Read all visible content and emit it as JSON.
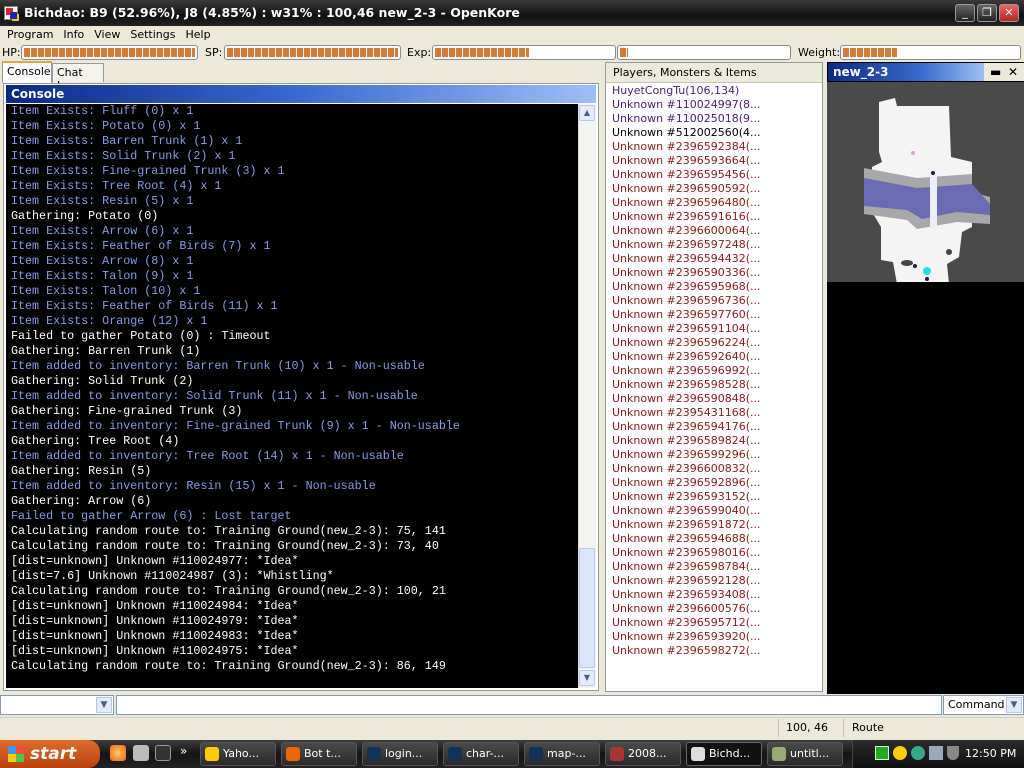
{
  "window": {
    "title": "Bichdao: B9 (52.96%), J8 (4.85%) : w31% : 100,46 new_2-3 - OpenKore"
  },
  "menu": [
    "Program",
    "Info",
    "View",
    "Settings",
    "Help"
  ],
  "stats": {
    "hp_label": "HP:",
    "sp_label": "SP:",
    "exp_label": "Exp:",
    "weight_label": "Weight:",
    "hp_percent": 100,
    "sp_percent": 100,
    "base_exp_percent": 52.96,
    "job_exp_percent": 4.85,
    "weight_percent": 31,
    "bar_color": "#d87a30"
  },
  "tabs": [
    "Console",
    "Chat Log"
  ],
  "console": {
    "title": "Console",
    "colors": {
      "info": "#8a9ae6",
      "normal": "#ffffff",
      "background": "#000000"
    },
    "lines": [
      {
        "t": "info",
        "text": "Item Exists: Fluff (0) x 1"
      },
      {
        "t": "info",
        "text": "Item Exists: Potato (0) x 1"
      },
      {
        "t": "info",
        "text": "Item Exists: Barren Trunk (1) x 1"
      },
      {
        "t": "info",
        "text": "Item Exists: Solid Trunk (2) x 1"
      },
      {
        "t": "info",
        "text": "Item Exists: Fine-grained Trunk (3) x 1"
      },
      {
        "t": "info",
        "text": "Item Exists: Tree Root (4) x 1"
      },
      {
        "t": "info",
        "text": "Item Exists: Resin (5) x 1"
      },
      {
        "t": "normal",
        "text": "Gathering: Potato (0)"
      },
      {
        "t": "info",
        "text": "Item Exists: Arrow (6) x 1"
      },
      {
        "t": "info",
        "text": "Item Exists: Feather of Birds (7) x 1"
      },
      {
        "t": "info",
        "text": "Item Exists: Arrow (8) x 1"
      },
      {
        "t": "info",
        "text": "Item Exists: Talon (9) x 1"
      },
      {
        "t": "info",
        "text": "Item Exists: Talon (10) x 1"
      },
      {
        "t": "info",
        "text": "Item Exists: Feather of Birds (11) x 1"
      },
      {
        "t": "info",
        "text": "Item Exists: Orange (12) x 1"
      },
      {
        "t": "normal",
        "text": "Failed to gather Potato (0) : Timeout"
      },
      {
        "t": "normal",
        "text": "Gathering: Barren Trunk (1)"
      },
      {
        "t": "info",
        "text": "Item added to inventory: Barren Trunk (10) x 1 - Non-usable"
      },
      {
        "t": "normal",
        "text": "Gathering: Solid Trunk (2)"
      },
      {
        "t": "info",
        "text": "Item added to inventory: Solid Trunk (11) x 1 - Non-usable"
      },
      {
        "t": "normal",
        "text": "Gathering: Fine-grained Trunk (3)"
      },
      {
        "t": "info",
        "text": "Item added to inventory: Fine-grained Trunk (9) x 1 - Non-usable"
      },
      {
        "t": "normal",
        "text": "Gathering: Tree Root (4)"
      },
      {
        "t": "info",
        "text": "Item added to inventory: Tree Root (14) x 1 - Non-usable"
      },
      {
        "t": "normal",
        "text": "Gathering: Resin (5)"
      },
      {
        "t": "info",
        "text": "Item added to inventory: Resin (15) x 1 - Non-usable"
      },
      {
        "t": "normal",
        "text": "Gathering: Arrow (6)"
      },
      {
        "t": "info",
        "text": "Failed to gather Arrow (6) : Lost target"
      },
      {
        "t": "normal",
        "text": "Calculating random route to: Training Ground(new_2-3): 75, 141"
      },
      {
        "t": "normal",
        "text": "Calculating random route to: Training Ground(new_2-3): 73, 40"
      },
      {
        "t": "normal",
        "text": "[dist=unknown] Unknown #110024977: *Idea*"
      },
      {
        "t": "normal",
        "text": "[dist=7.6] Unknown #110024987 (3): *Whistling*"
      },
      {
        "t": "normal",
        "text": "Calculating random route to: Training Ground(new_2-3): 100, 21"
      },
      {
        "t": "normal",
        "text": "[dist=unknown] Unknown #110024984: *Idea*"
      },
      {
        "t": "normal",
        "text": "[dist=unknown] Unknown #110024979: *Idea*"
      },
      {
        "t": "normal",
        "text": "[dist=unknown] Unknown #110024983: *Idea*"
      },
      {
        "t": "normal",
        "text": "[dist=unknown] Unknown #110024975: *Idea*"
      },
      {
        "t": "normal",
        "text": "Calculating random route to: Training Ground(new_2-3): 86, 149"
      }
    ]
  },
  "entities": {
    "header": "Players, Monsters & Items",
    "colors": {
      "player": "#4b1f7a",
      "npc": "#000000",
      "monster": "#8b1a1a"
    },
    "items": [
      {
        "t": "player",
        "text": "HuyetCongTu(106,134)"
      },
      {
        "t": "player",
        "text": "Unknown #110024997(8..."
      },
      {
        "t": "player",
        "text": "Unknown #110025018(9..."
      },
      {
        "t": "npc",
        "text": "Unknown #512002560(4..."
      },
      {
        "t": "monster",
        "text": "Unknown #2396592384(..."
      },
      {
        "t": "monster",
        "text": "Unknown #2396593664(..."
      },
      {
        "t": "monster",
        "text": "Unknown #2396595456(..."
      },
      {
        "t": "monster",
        "text": "Unknown #2396590592(..."
      },
      {
        "t": "monster",
        "text": "Unknown #2396596480(..."
      },
      {
        "t": "monster",
        "text": "Unknown #2396591616(..."
      },
      {
        "t": "monster",
        "text": "Unknown #2396600064(..."
      },
      {
        "t": "monster",
        "text": "Unknown #2396597248(..."
      },
      {
        "t": "monster",
        "text": "Unknown #2396594432(..."
      },
      {
        "t": "monster",
        "text": "Unknown #2396590336(..."
      },
      {
        "t": "monster",
        "text": "Unknown #2396595968(..."
      },
      {
        "t": "monster",
        "text": "Unknown #2396596736(..."
      },
      {
        "t": "monster",
        "text": "Unknown #2396597760(..."
      },
      {
        "t": "monster",
        "text": "Unknown #2396591104(..."
      },
      {
        "t": "monster",
        "text": "Unknown #2396596224(..."
      },
      {
        "t": "monster",
        "text": "Unknown #2396592640(..."
      },
      {
        "t": "monster",
        "text": "Unknown #2396596992(..."
      },
      {
        "t": "monster",
        "text": "Unknown #2396598528(..."
      },
      {
        "t": "monster",
        "text": "Unknown #2396590848(..."
      },
      {
        "t": "monster",
        "text": "Unknown #2395431168(..."
      },
      {
        "t": "monster",
        "text": "Unknown #2396594176(..."
      },
      {
        "t": "monster",
        "text": "Unknown #2396589824(..."
      },
      {
        "t": "monster",
        "text": "Unknown #2396599296(..."
      },
      {
        "t": "monster",
        "text": "Unknown #2396600832(..."
      },
      {
        "t": "monster",
        "text": "Unknown #2396592896(..."
      },
      {
        "t": "monster",
        "text": "Unknown #2396593152(..."
      },
      {
        "t": "monster",
        "text": "Unknown #2396599040(..."
      },
      {
        "t": "monster",
        "text": "Unknown #2396591872(..."
      },
      {
        "t": "monster",
        "text": "Unknown #2396594688(..."
      },
      {
        "t": "monster",
        "text": "Unknown #2396598016(..."
      },
      {
        "t": "monster",
        "text": "Unknown #2396598784(..."
      },
      {
        "t": "monster",
        "text": "Unknown #2396592128(..."
      },
      {
        "t": "monster",
        "text": "Unknown #2396593408(..."
      },
      {
        "t": "monster",
        "text": "Unknown #2396600576(..."
      },
      {
        "t": "monster",
        "text": "Unknown #2396595712(..."
      },
      {
        "t": "monster",
        "text": "Unknown #2396593920(..."
      },
      {
        "t": "monster",
        "text": "Unknown #2396598272(..."
      }
    ]
  },
  "map": {
    "title": "new_2-3"
  },
  "input": {
    "left_combo_value": "",
    "command_value": "",
    "mode": "Command"
  },
  "status": {
    "position": "100, 46",
    "state": "Route"
  },
  "taskbar": {
    "start": "start",
    "tasks": [
      "Yaho...",
      "Bot t...",
      "login...",
      "char-...",
      "map-...",
      "2008...",
      "Bichd...",
      "untitl..."
    ],
    "active_task": "Bichd...",
    "clock": "12:50 PM"
  }
}
